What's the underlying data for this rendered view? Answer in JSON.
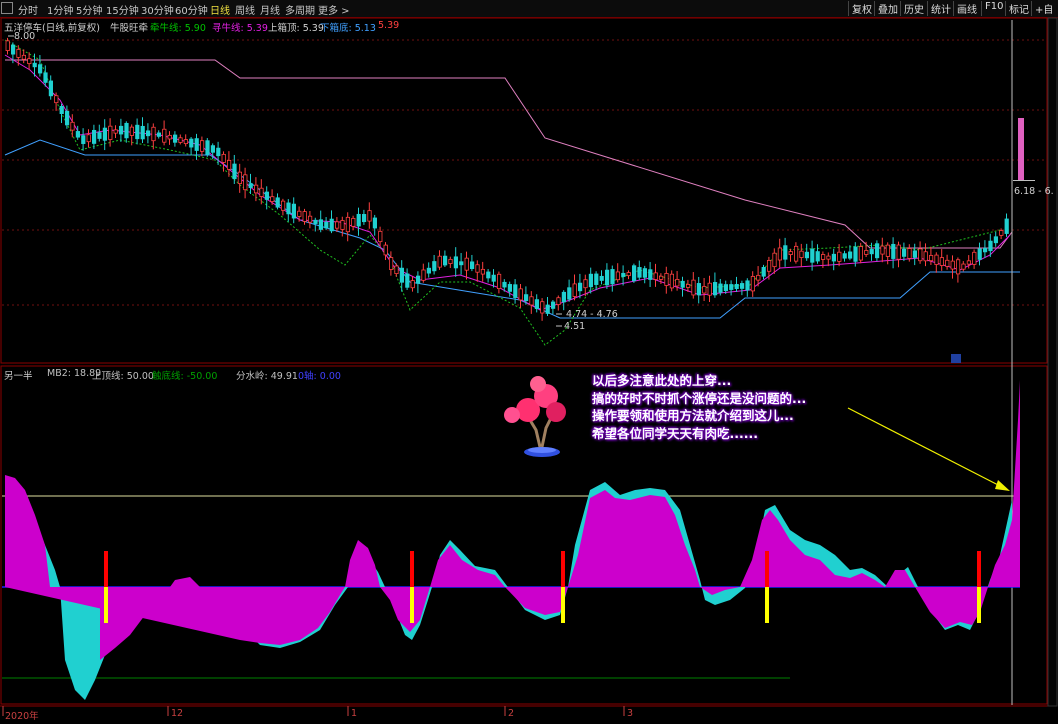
{
  "toolbar": {
    "periods": [
      "分时",
      "1分钟",
      "5分钟",
      "15分钟",
      "30分钟",
      "60分钟",
      "日线",
      "周线",
      "月线",
      "多周期",
      "更多 >"
    ],
    "active_period": "日线",
    "right_buttons": [
      "复权",
      "叠加",
      "历史",
      "统计",
      "画线",
      "F10",
      "标记",
      "+自"
    ]
  },
  "main_panel": {
    "title": "五洋停车(日线,前复权)",
    "indicator_name": "牛股旺牵",
    "legend": [
      {
        "label": "牵牛线:",
        "value": "5.90",
        "color": "#00c000"
      },
      {
        "label": "寻牛线:",
        "value": "5.39",
        "color": "#e020e0"
      },
      {
        "label": "上箱顶:",
        "value": "5.39",
        "color": "#d0d0d0"
      },
      {
        "label": "下箱底:",
        "value": "5.13",
        "color": "#40a0ff"
      },
      {
        "label": "",
        "value": "5.39",
        "color": "#ff4040"
      }
    ],
    "price_high_label": "8.00",
    "price_low_label": "4.51",
    "range_label": "4.74 - 4.76",
    "right_range_label": "6.18 - 6.",
    "marker_icon": "bookmark-icon"
  },
  "sub_panel": {
    "name": "另一半",
    "legend": [
      {
        "label": "MB2:",
        "value": "18.89",
        "color": "#c0c0c0"
      },
      {
        "label": "上顶线:",
        "value": "50.00",
        "color": "#c0c0c0"
      },
      {
        "label": "触底线:",
        "value": "-50.00",
        "color": "#00a000"
      },
      {
        "label": "分水岭:",
        "value": "49.91",
        "color": "#c0c0c0"
      },
      {
        "label": "0轴:",
        "value": "0.00",
        "color": "#4040ff"
      }
    ]
  },
  "callout": {
    "lines": [
      "以后多注意此处的上穿...",
      "搞的好时不时抓个涨停还是没问题的...",
      "操作要领和使用方法就介绍到这儿...",
      "希望各位同学天天有肉吃......"
    ],
    "decoration": "bonsai-tree-icon"
  },
  "x_axis": {
    "labels": [
      "2020年",
      "12",
      "1",
      "2",
      "3"
    ]
  }
}
